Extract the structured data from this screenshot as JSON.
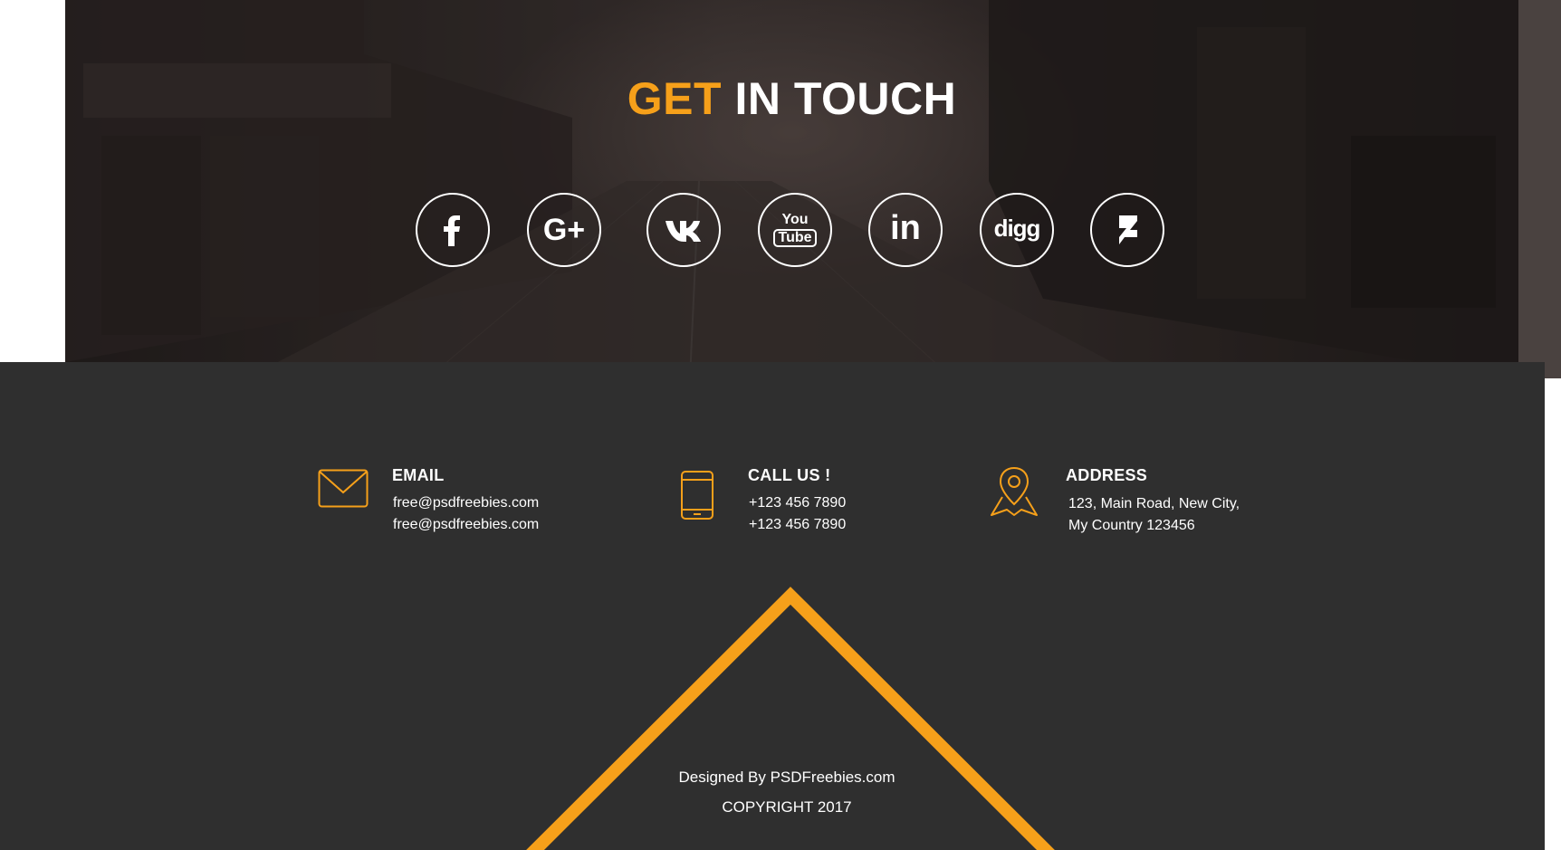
{
  "hero": {
    "title_accent": "GET",
    "title_rest": "IN TOUCH",
    "socials": [
      {
        "icon": "facebook-icon"
      },
      {
        "icon": "google-plus-icon",
        "label": "G+"
      },
      {
        "icon": "vk-icon"
      },
      {
        "icon": "youtube-icon",
        "label_top": "You",
        "label_bottom": "Tube"
      },
      {
        "icon": "linkedin-icon",
        "label": "in"
      },
      {
        "icon": "digg-icon",
        "label": "digg"
      },
      {
        "icon": "deviantart-icon"
      }
    ]
  },
  "contacts": {
    "email": {
      "title": "EMAIL",
      "lines": [
        "free@psdfreebies.com",
        "free@psdfreebies.com"
      ],
      "icon": "envelope-icon"
    },
    "phone": {
      "title": "CALL US !",
      "lines": [
        "+123 456 7890",
        "+123 456 7890"
      ],
      "icon": "mobile-phone-icon"
    },
    "address": {
      "title": "ADDRESS",
      "lines": [
        "123, Main Road, New City,",
        "My Country 123456"
      ],
      "icon": "map-pin-icon"
    }
  },
  "footer": {
    "designed_by": "Designed By PSDFreebies.com",
    "copyright": "COPYRIGHT 2017"
  },
  "colors": {
    "accent": "#f6a01a",
    "footer_bg": "#2f2f2f",
    "text": "#ffffff"
  }
}
